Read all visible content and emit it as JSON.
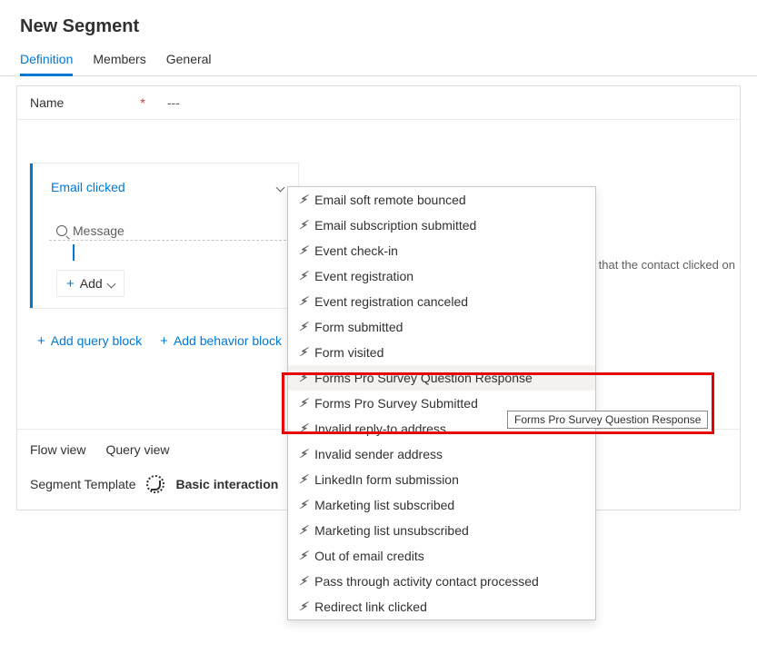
{
  "page_title": "New Segment",
  "tabs": [
    "Definition",
    "Members",
    "General"
  ],
  "active_tab": 0,
  "name": {
    "label": "Name",
    "value": "---"
  },
  "block": {
    "selected": "Email clicked",
    "search_placeholder": "Message",
    "add_label": "Add"
  },
  "hint_text": "ail that the contact clicked on",
  "actions": {
    "add_query": "Add query block",
    "add_behavior": "Add behavior block"
  },
  "footer": {
    "flow": "Flow view",
    "query": "Query view",
    "tmpl_label": "Segment Template",
    "tmpl_value": "Basic interaction"
  },
  "dropdown": [
    "Email soft remote bounced",
    "Email subscription submitted",
    "Event check-in",
    "Event registration",
    "Event registration canceled",
    "Form submitted",
    "Form visited",
    "Forms Pro Survey Question Response",
    "Forms Pro Survey Submitted",
    "Invalid reply-to address",
    "Invalid sender address",
    "LinkedIn form submission",
    "Marketing list subscribed",
    "Marketing list unsubscribed",
    "Out of email credits",
    "Pass through activity contact processed",
    "Redirect link clicked"
  ],
  "hovered_index": 7,
  "tooltip": "Forms Pro Survey Question Response"
}
